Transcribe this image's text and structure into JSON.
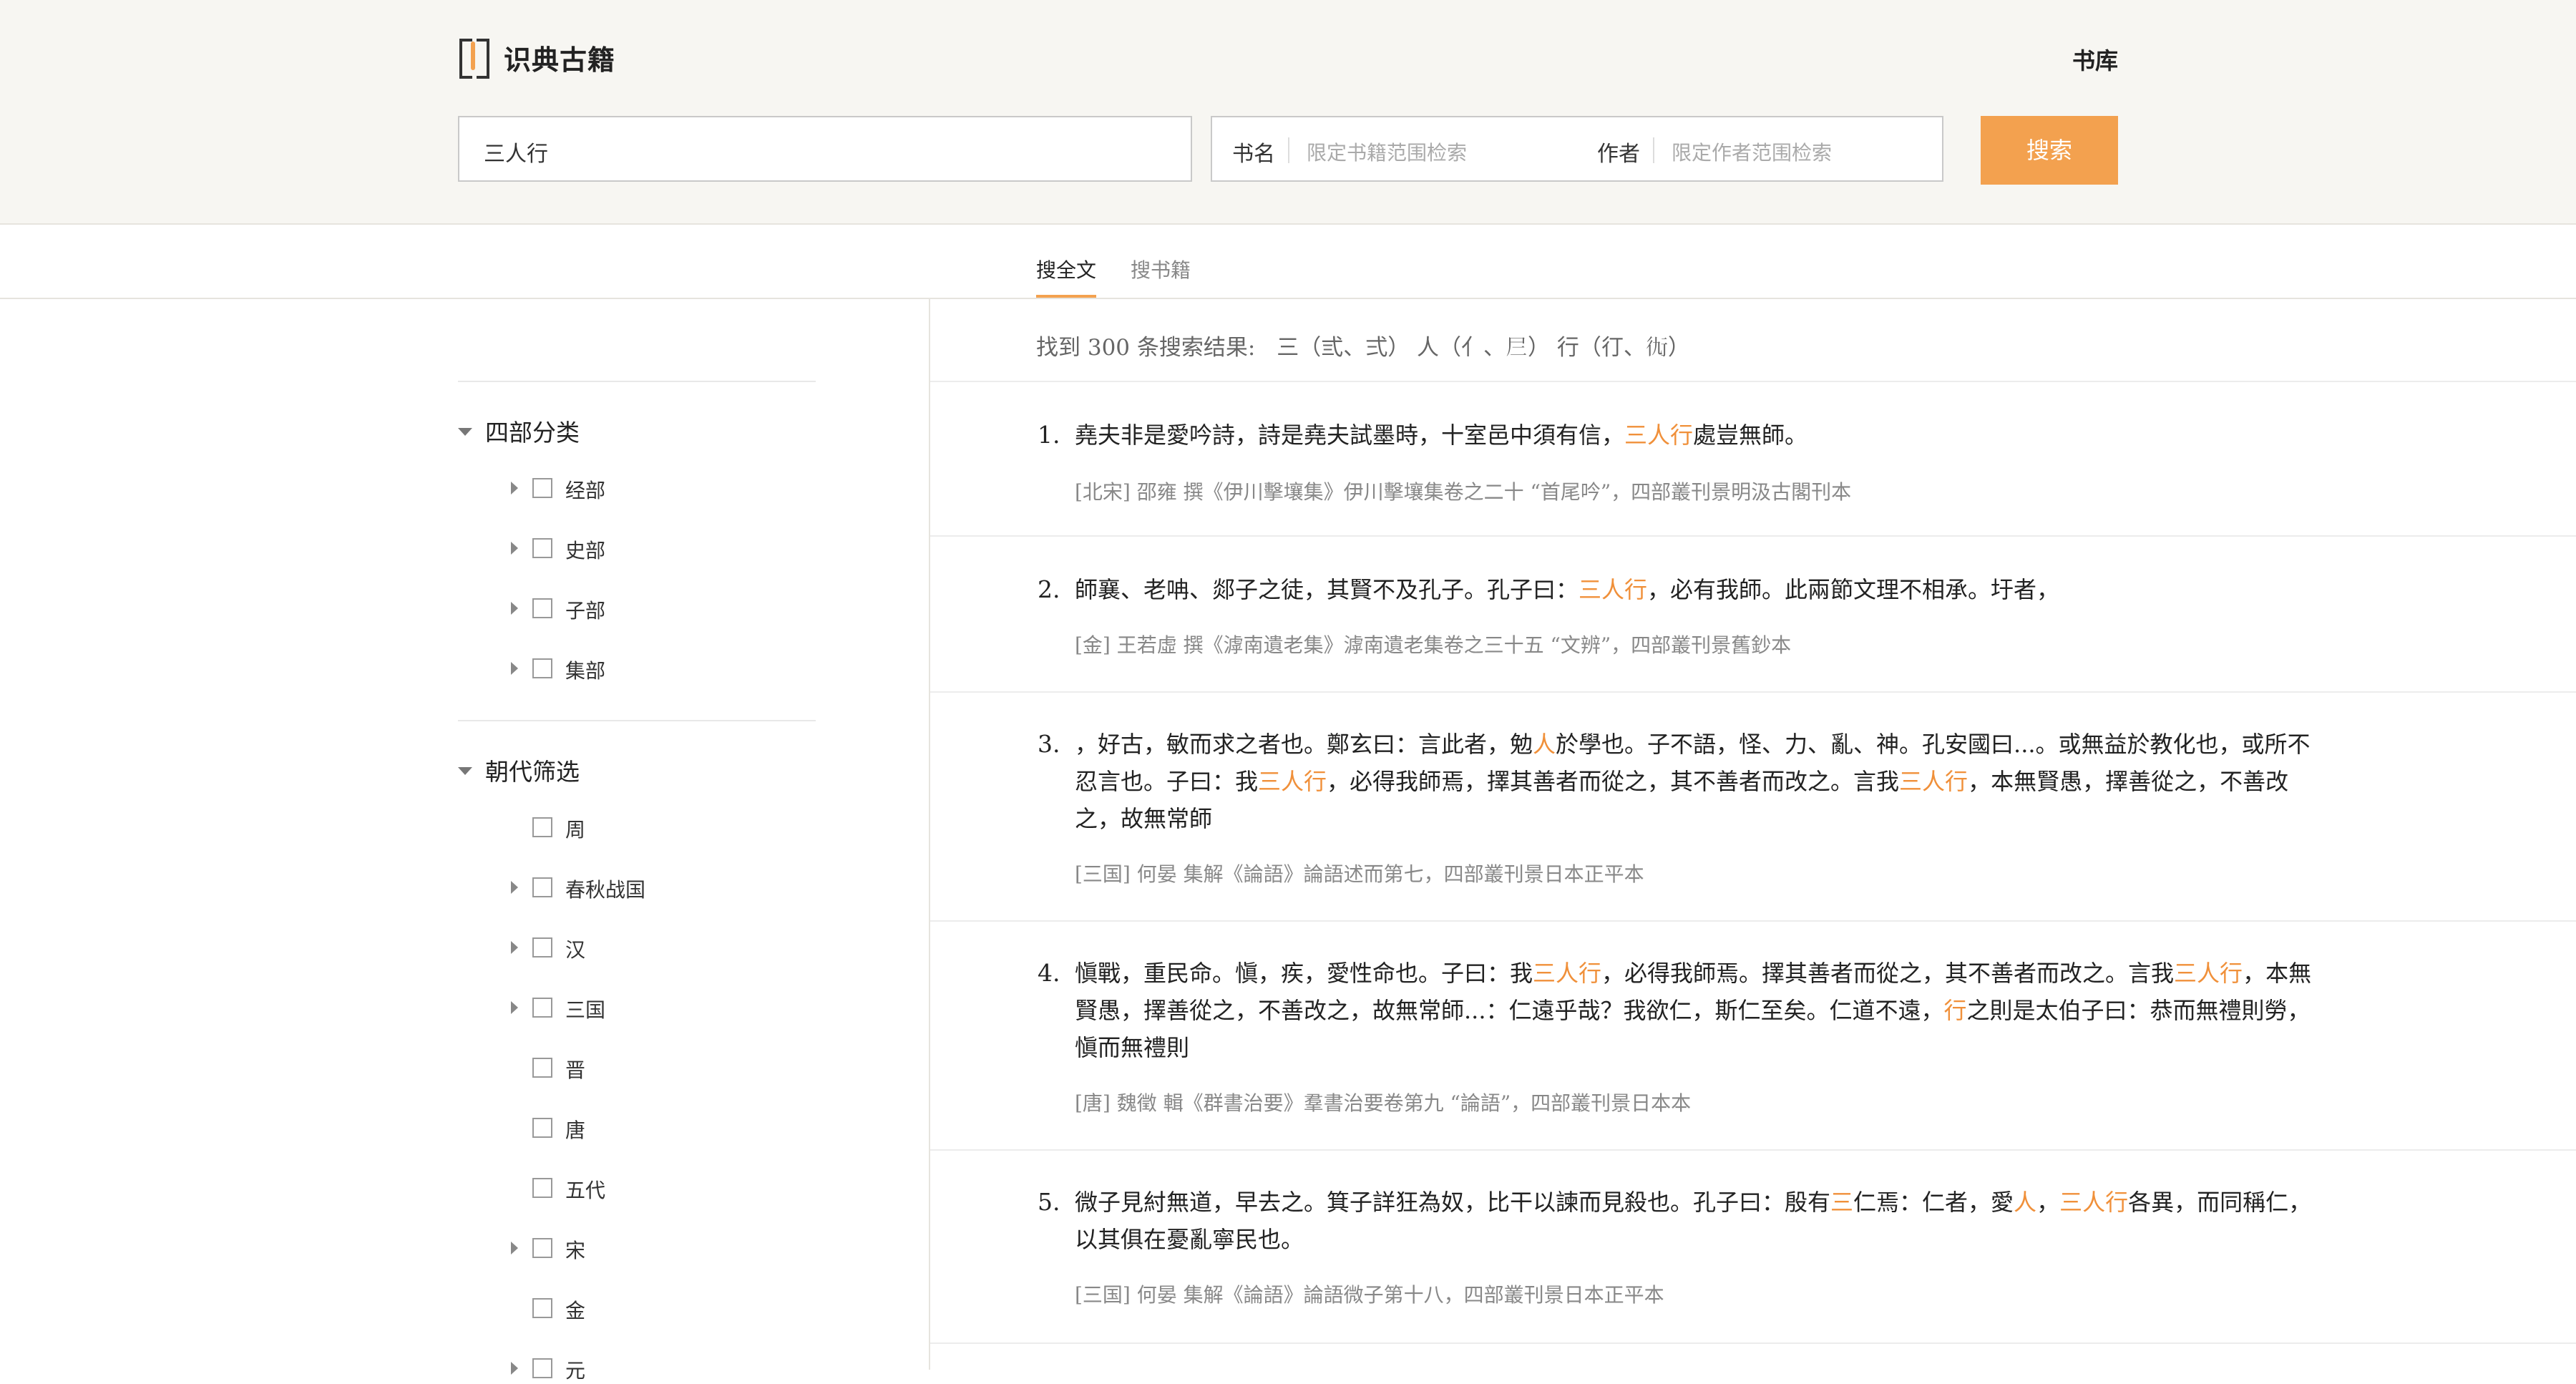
{
  "header": {
    "logo_text": "识典古籍",
    "nav_library": "书库",
    "search": {
      "query": "三人行",
      "book_label": "书名",
      "book_placeholder": "限定书籍范围检索",
      "author_label": "作者",
      "author_placeholder": "限定作者范围检索",
      "button": "搜索"
    }
  },
  "tabs": [
    {
      "label": "搜全文",
      "active": true
    },
    {
      "label": "搜书籍",
      "active": false
    }
  ],
  "sidebar": {
    "sections": [
      {
        "title": "四部分类",
        "items": [
          {
            "label": "经部",
            "expandable": true
          },
          {
            "label": "史部",
            "expandable": true
          },
          {
            "label": "子部",
            "expandable": true
          },
          {
            "label": "集部",
            "expandable": true
          }
        ]
      },
      {
        "title": "朝代筛选",
        "items": [
          {
            "label": "周",
            "expandable": false
          },
          {
            "label": "春秋战国",
            "expandable": true
          },
          {
            "label": "汉",
            "expandable": true
          },
          {
            "label": "三国",
            "expandable": true
          },
          {
            "label": "晋",
            "expandable": false
          },
          {
            "label": "唐",
            "expandable": false
          },
          {
            "label": "五代",
            "expandable": false
          },
          {
            "label": "宋",
            "expandable": true
          },
          {
            "label": "金",
            "expandable": false
          },
          {
            "label": "元",
            "expandable": true
          }
        ]
      }
    ]
  },
  "results": {
    "summary_prefix": "找到",
    "count": "300",
    "summary_suffix": "条搜索结果:",
    "variants": "三（弎、弍） 人（亻、𡰥） 行（㣔、𧗝）",
    "items": [
      {
        "num": "1.",
        "segments": [
          {
            "t": "堯夫非是愛吟詩，詩是堯夫試墨時，十室邑中須有信，"
          },
          {
            "t": "三人行",
            "hl": true
          },
          {
            "t": "處豈無師。"
          }
        ],
        "source": "[北宋] 邵雍 撰《伊川擊壤集》伊川擊壤集卷之二十 “首尾吟”，四部叢刊景明汲古閣刊本"
      },
      {
        "num": "2.",
        "segments": [
          {
            "t": "師襄、老呥、郯子之徒，其賢不及孔子。孔子曰："
          },
          {
            "t": "三人行",
            "hl": true
          },
          {
            "t": "，必有我師。此兩節文理不相承。圩者，"
          }
        ],
        "source": "[金] 王若虛 撰《滹南遺老集》滹南遺老集卷之三十五 “文辨”，四部叢刊景舊鈔本"
      },
      {
        "num": "3.",
        "segments": [
          {
            "t": "，好古，敏而求之者也。鄭玄曰：言此者，勉"
          },
          {
            "t": "人",
            "hl": true
          },
          {
            "t": "於學也。子不語，怪、力、亂、神。孔安國曰...。或無益於教化也，或所不忍言也。子曰：我"
          },
          {
            "t": "三人行",
            "hl": true
          },
          {
            "t": "，必得我師焉，擇其善者而從之，其不善者而改之。言我"
          },
          {
            "t": "三人行",
            "hl": true
          },
          {
            "t": "，本無賢愚，擇善從之，不善改之，故無常師"
          }
        ],
        "source": "[三国] 何晏 集解《論語》論語述而第七，四部叢刊景日本正平本"
      },
      {
        "num": "4.",
        "segments": [
          {
            "t": "愼戰，重民命。愼，疾，愛性命也。子曰：我"
          },
          {
            "t": "三人行",
            "hl": true
          },
          {
            "t": "，必得我師焉。擇其善者而從之，其不善者而改之。言我"
          },
          {
            "t": "三人行",
            "hl": true
          },
          {
            "t": "，本無賢愚，擇善從之，不善改之，故無常師...：仁遠乎哉？我欲仁，斯仁至矣。仁道不遠，"
          },
          {
            "t": "行",
            "hl": true
          },
          {
            "t": "之則是太伯子曰：恭而無禮則勞，愼而無禮則"
          }
        ],
        "source": "[唐] 魏徵 輯《群書治要》羣書治要卷第九 “論語”，四部叢刊景日本本"
      },
      {
        "num": "5.",
        "segments": [
          {
            "t": "微子見紂無道，早去之。箕子詳狂為奴，比干以諫而見殺也。孔子曰：殷有"
          },
          {
            "t": "三",
            "hl": true
          },
          {
            "t": "仁焉：仁者，愛"
          },
          {
            "t": "人",
            "hl": true
          },
          {
            "t": "，"
          },
          {
            "t": "三人行",
            "hl": true
          },
          {
            "t": "各異，而同稱仁，以其俱在憂亂寧民也。"
          }
        ],
        "source": "[三国] 何晏 集解《論語》論語微子第十八，四部叢刊景日本正平本"
      }
    ]
  }
}
